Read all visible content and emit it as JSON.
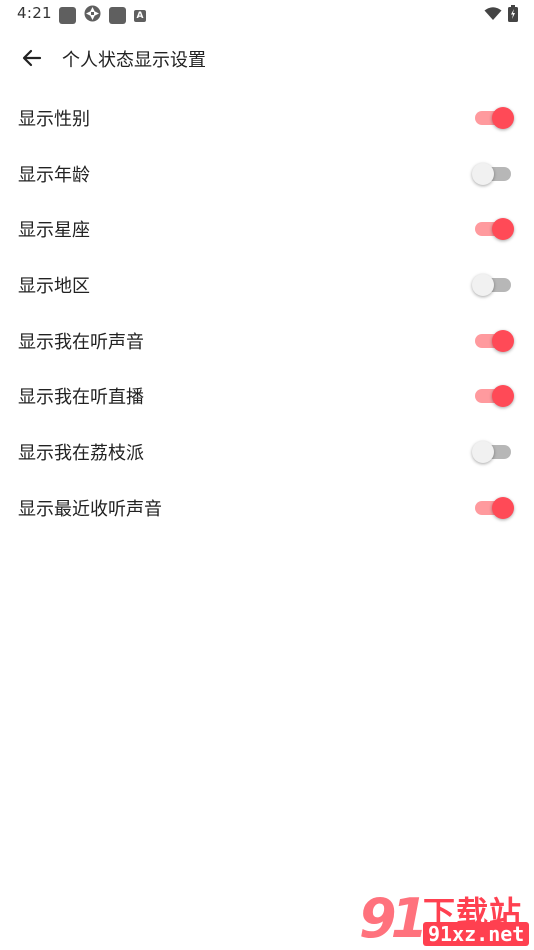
{
  "status_bar": {
    "time": "4:21",
    "left_icons": [
      "notification-square-icon",
      "aperture-icon",
      "notification-square-icon",
      "a-badge-icon"
    ],
    "a_badge_text": "A",
    "right_icons": [
      "wifi-icon",
      "battery-charging-icon"
    ]
  },
  "header": {
    "title": "个人状态显示设置",
    "back_icon": "arrow-left-icon"
  },
  "settings": [
    {
      "label": "显示性别",
      "on": true
    },
    {
      "label": "显示年龄",
      "on": false
    },
    {
      "label": "显示星座",
      "on": true
    },
    {
      "label": "显示地区",
      "on": false
    },
    {
      "label": "显示我在听声音",
      "on": true
    },
    {
      "label": "显示我在听直播",
      "on": true
    },
    {
      "label": "显示我在荔枝派",
      "on": false
    },
    {
      "label": "显示最近收听声音",
      "on": true
    }
  ],
  "watermark": {
    "logo": "91",
    "title": "下载站",
    "subtitle": "91xz.net"
  },
  "colors": {
    "toggle_on_thumb": "#ff4a57",
    "toggle_on_track": "#ff9a9e",
    "toggle_off_thumb": "#f1f1f1",
    "toggle_off_track": "#b7b7b7",
    "watermark": "#ff4050"
  }
}
